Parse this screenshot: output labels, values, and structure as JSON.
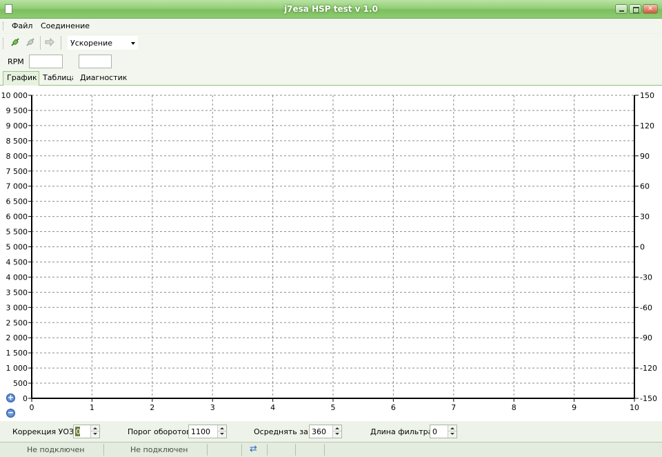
{
  "window": {
    "title": "j7esa HSP test v 1.0"
  },
  "menu": {
    "items": [
      "Файл",
      "Соединение"
    ]
  },
  "toolbar": {
    "mode_select": "Ускорение"
  },
  "rpm": {
    "label": "RPM",
    "value1": "",
    "value2": ""
  },
  "tabs": [
    "График",
    "Таблица",
    "Диагностика"
  ],
  "chart_data": {
    "type": "line",
    "title": "",
    "x_ticks": [
      "0",
      "1",
      "2",
      "3",
      "4",
      "5",
      "6",
      "7",
      "8",
      "9",
      "10"
    ],
    "xlim": [
      0,
      10
    ],
    "y_left_ticks": [
      "10 000",
      "9 500",
      "9 000",
      "8 500",
      "8 000",
      "7 500",
      "7 000",
      "6 500",
      "6 000",
      "5 500",
      "5 000",
      "4 500",
      "4 000",
      "3 500",
      "3 000",
      "2 500",
      "2 000",
      "1 500",
      "1 000",
      "500",
      "0"
    ],
    "y_left_lim": [
      0,
      10000
    ],
    "y_right_ticks": [
      "150",
      "120",
      "90",
      "60",
      "30",
      "0",
      "-30",
      "-60",
      "-90",
      "-120",
      "-150"
    ],
    "y_right_lim": [
      -150,
      150
    ],
    "grid": true,
    "series": []
  },
  "controls": {
    "correction": {
      "label": "Коррекция УОЗ",
      "value": "0"
    },
    "threshold": {
      "label": "Порог оборотов",
      "value": "1100"
    },
    "average": {
      "label": "Осреднять за",
      "value": "360"
    },
    "filter": {
      "label": "Длина фильтра",
      "value": "0"
    }
  },
  "status": {
    "left": "Не подключен",
    "right": "Не подключен"
  },
  "colors": {
    "titlebar": "#93cf77",
    "grid": "#8a8a8a",
    "axis": "#000000"
  }
}
